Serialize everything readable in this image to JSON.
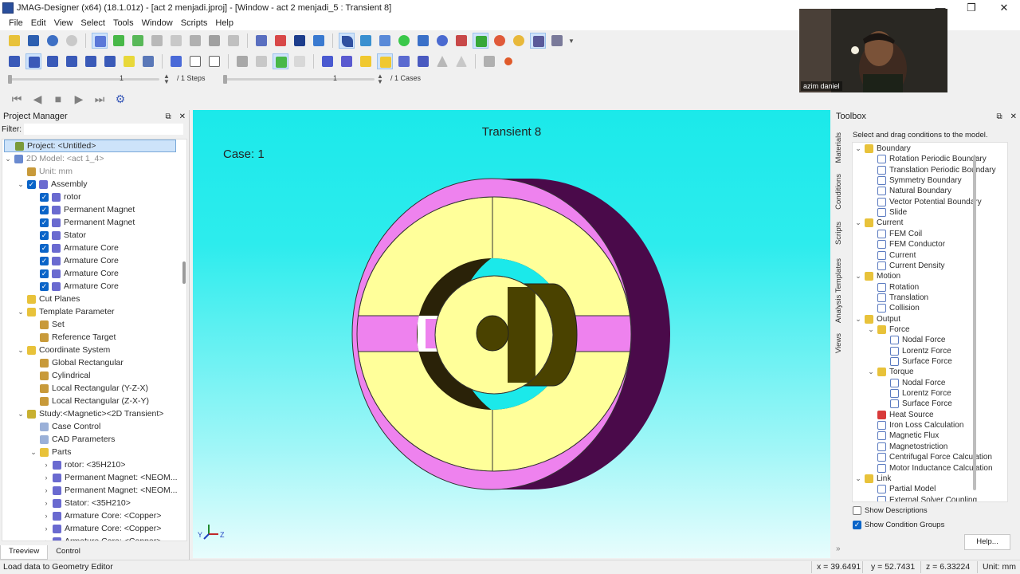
{
  "window": {
    "title": "JMAG-Designer (x64) (18.1.01z) - [act 2 menjadi.jproj] - [Window - act 2 menjadi_5 : Transient 8]",
    "minimize": "—",
    "restore": "❐",
    "close": "✕"
  },
  "menu": [
    "File",
    "Edit",
    "View",
    "Select",
    "Tools",
    "Window",
    "Scripts",
    "Help"
  ],
  "steps": {
    "value": "1",
    "label": "/ 1 Steps"
  },
  "cases": {
    "value": "1",
    "label": "/ 1 Cases"
  },
  "project_manager": {
    "title": "Project Manager",
    "filter_label": "Filter:",
    "tree": [
      {
        "label": "Project: <Untitled>",
        "depth": 0,
        "exp": "",
        "icon": "project",
        "sel": true
      },
      {
        "label": "2D Model: <act 1_4>",
        "depth": 0,
        "exp": "v",
        "icon": "model",
        "dim": true
      },
      {
        "label": "Unit: mm",
        "depth": 1,
        "exp": "",
        "icon": "unit",
        "dim": true
      },
      {
        "label": "Assembly",
        "depth": 1,
        "exp": "v",
        "icon": "part",
        "cb": true
      },
      {
        "label": "rotor",
        "depth": 2,
        "exp": "",
        "icon": "part",
        "cb": true
      },
      {
        "label": "Permanent Magnet",
        "depth": 2,
        "exp": "",
        "icon": "part",
        "cb": true
      },
      {
        "label": "Permanent Magnet",
        "depth": 2,
        "exp": "",
        "icon": "part",
        "cb": true
      },
      {
        "label": "Stator",
        "depth": 2,
        "exp": "",
        "icon": "part",
        "cb": true
      },
      {
        "label": "Armature Core",
        "depth": 2,
        "exp": "",
        "icon": "part",
        "cb": true
      },
      {
        "label": "Armature Core",
        "depth": 2,
        "exp": "",
        "icon": "part",
        "cb": true
      },
      {
        "label": "Armature Core",
        "depth": 2,
        "exp": "",
        "icon": "part",
        "cb": true
      },
      {
        "label": "Armature Core",
        "depth": 2,
        "exp": "",
        "icon": "part",
        "cb": true
      },
      {
        "label": "Cut Planes",
        "depth": 1,
        "exp": "",
        "icon": "folder"
      },
      {
        "label": "Template Parameter",
        "depth": 1,
        "exp": "v",
        "icon": "folder"
      },
      {
        "label": "Set",
        "depth": 2,
        "exp": "",
        "icon": "unit"
      },
      {
        "label": "Reference Target",
        "depth": 2,
        "exp": "",
        "icon": "unit"
      },
      {
        "label": "Coordinate System",
        "depth": 1,
        "exp": "v",
        "icon": "folder"
      },
      {
        "label": "Global Rectangular",
        "depth": 2,
        "exp": "",
        "icon": "unit"
      },
      {
        "label": "Cylindrical",
        "depth": 2,
        "exp": "",
        "icon": "unit"
      },
      {
        "label": "Local Rectangular (Y-Z-X)",
        "depth": 2,
        "exp": "",
        "icon": "unit"
      },
      {
        "label": "Local Rectangular (Z-X-Y)",
        "depth": 2,
        "exp": "",
        "icon": "unit"
      },
      {
        "label": "Study:<Magnetic><2D Transient>",
        "depth": 1,
        "exp": "v",
        "icon": "study"
      },
      {
        "label": "Case Control",
        "depth": 2,
        "exp": "",
        "icon": "doc"
      },
      {
        "label": "CAD Parameters",
        "depth": 2,
        "exp": "",
        "icon": "doc"
      },
      {
        "label": "Parts",
        "depth": 2,
        "exp": "v",
        "icon": "folder"
      },
      {
        "label": "rotor: <35H210>",
        "depth": 3,
        "exp": ">",
        "icon": "part"
      },
      {
        "label": "Permanent Magnet: <NEOM...",
        "depth": 3,
        "exp": ">",
        "icon": "part"
      },
      {
        "label": "Permanent Magnet: <NEOM...",
        "depth": 3,
        "exp": ">",
        "icon": "part"
      },
      {
        "label": "Stator: <35H210>",
        "depth": 3,
        "exp": ">",
        "icon": "part"
      },
      {
        "label": "Armature Core: <Copper>",
        "depth": 3,
        "exp": ">",
        "icon": "part"
      },
      {
        "label": "Armature Core: <Copper>",
        "depth": 3,
        "exp": ">",
        "icon": "part"
      },
      {
        "label": "Armature Core: <Copper>",
        "depth": 3,
        "exp": ">",
        "icon": "part"
      }
    ],
    "tabs": [
      "Treeview",
      "Control"
    ]
  },
  "viewport": {
    "title": "Transient 8",
    "case_label": "Case: 1",
    "axis_y": "Y",
    "axis_z": "Z"
  },
  "toolbox": {
    "title": "Toolbox",
    "hint": "Select and drag conditions to the model.",
    "vertical_tabs": [
      "Materials",
      "Conditions",
      "Scripts",
      "Analysis Templates",
      "Views"
    ],
    "tree": [
      {
        "label": "Boundary",
        "depth": 0,
        "exp": "v",
        "icon": "folder"
      },
      {
        "label": "Rotation Periodic Boundary",
        "depth": 1,
        "icon": "cond"
      },
      {
        "label": "Translation Periodic Boundary",
        "depth": 1,
        "icon": "cond"
      },
      {
        "label": "Symmetry Boundary",
        "depth": 1,
        "icon": "cond"
      },
      {
        "label": "Natural Boundary",
        "depth": 1,
        "icon": "cond"
      },
      {
        "label": "Vector Potential Boundary",
        "depth": 1,
        "icon": "cond"
      },
      {
        "label": "Slide",
        "depth": 1,
        "icon": "cond"
      },
      {
        "label": "Current",
        "depth": 0,
        "exp": "v",
        "icon": "folder"
      },
      {
        "label": "FEM Coil",
        "depth": 1,
        "icon": "cond"
      },
      {
        "label": "FEM Conductor",
        "depth": 1,
        "icon": "cond"
      },
      {
        "label": "Current",
        "depth": 1,
        "icon": "cond"
      },
      {
        "label": "Current Density",
        "depth": 1,
        "icon": "cond"
      },
      {
        "label": "Motion",
        "depth": 0,
        "exp": "v",
        "icon": "folder"
      },
      {
        "label": "Rotation",
        "depth": 1,
        "icon": "cond"
      },
      {
        "label": "Translation",
        "depth": 1,
        "icon": "cond"
      },
      {
        "label": "Collision",
        "depth": 1,
        "icon": "cond"
      },
      {
        "label": "Output",
        "depth": 0,
        "exp": "v",
        "icon": "folder"
      },
      {
        "label": "Force",
        "depth": 1,
        "exp": "v",
        "icon": "folder"
      },
      {
        "label": "Nodal Force",
        "depth": 2,
        "icon": "cond"
      },
      {
        "label": "Lorentz Force",
        "depth": 2,
        "icon": "cond"
      },
      {
        "label": "Surface Force",
        "depth": 2,
        "icon": "cond"
      },
      {
        "label": "Torque",
        "depth": 1,
        "exp": "v",
        "icon": "folder"
      },
      {
        "label": "Nodal Force",
        "depth": 2,
        "icon": "cond"
      },
      {
        "label": "Lorentz Force",
        "depth": 2,
        "icon": "cond"
      },
      {
        "label": "Surface Force",
        "depth": 2,
        "icon": "cond"
      },
      {
        "label": "Heat Source",
        "depth": 1,
        "icon": "heat"
      },
      {
        "label": "Iron Loss Calculation",
        "depth": 1,
        "icon": "cond"
      },
      {
        "label": "Magnetic Flux",
        "depth": 1,
        "icon": "cond"
      },
      {
        "label": "Magnetostriction",
        "depth": 1,
        "icon": "cond"
      },
      {
        "label": "Centrifugal Force Calculation",
        "depth": 1,
        "icon": "cond"
      },
      {
        "label": "Motor Inductance Calculation",
        "depth": 1,
        "icon": "cond"
      },
      {
        "label": "Link",
        "depth": 0,
        "exp": "v",
        "icon": "folder"
      },
      {
        "label": "Partial Model",
        "depth": 1,
        "icon": "cond"
      },
      {
        "label": "External Solver Coupling",
        "depth": 1,
        "icon": "cond"
      }
    ],
    "show_descriptions": "Show Descriptions",
    "show_condition_groups": "Show Condition Groups",
    "help": "Help..."
  },
  "status": {
    "message": "Load data to Geometry Editor",
    "x": "x = 39.6491",
    "y": "y = 52.7431",
    "z": "z = 6.33224",
    "unit": "Unit: mm"
  },
  "webcam": {
    "name": "azim daniel"
  },
  "colors": {
    "viewport_top": "#1be9ea",
    "stator_pink": "#ee82ee",
    "core_yellow": "#ffff9a",
    "stator_side": "#4a0a4a",
    "rotor_dark": "#2a2208",
    "magnet_olive": "#4a4200",
    "tree_selected": "#cde3fa",
    "checkbox_blue": "#0a64c8"
  }
}
